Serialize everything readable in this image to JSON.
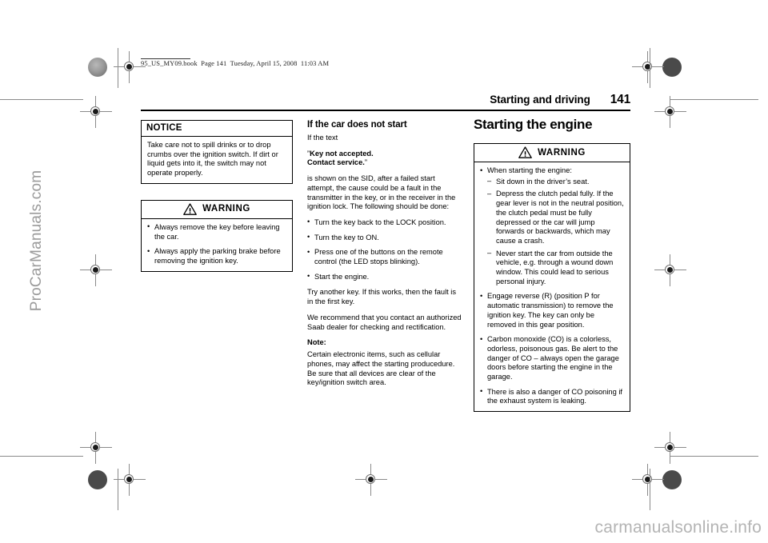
{
  "document": {
    "book_header": "95_US_MY09.book  Page 141  Tuesday, April 15, 2008  11:03 AM",
    "running_head_title": "Starting and driving",
    "page_number": "141"
  },
  "watermarks": {
    "left": "ProCarManuals.com",
    "bottom_right": "carmanualsonline.info"
  },
  "left_column": {
    "notice_box": {
      "title": "NOTICE",
      "body": "Take care not to spill drinks or to drop crumbs over the ignition switch. If dirt or liquid gets into it, the switch may not operate properly."
    },
    "warning_box": {
      "title": "WARNING",
      "icon": "warning-triangle-icon",
      "items": [
        "Always remove the key before leaving the car.",
        "Always apply the parking brake before removing the ignition key."
      ]
    }
  },
  "middle_column": {
    "heading": "If the car does not start",
    "intro": "If the text",
    "quote_open": "”",
    "quote_line1": "Key not accepted.",
    "quote_line2": "Contact service.",
    "quote_close": "”",
    "paragraph1": "is shown on the SID, after a failed start attempt, the cause could be a fault in the transmitter in the key, or in the receiver in the ignition lock. The following should be done:",
    "steps": [
      "Turn the key back to the LOCK position.",
      "Turn the key to ON.",
      "Press one of the buttons on the remote control (the LED stops blinking).",
      "Start the engine."
    ],
    "paragraph2": "Try another key. If this works, then the fault is in the first key.",
    "paragraph3": "We recommend that you contact an authorized Saab dealer for checking and rectification.",
    "note_label": "Note:",
    "note_text": "Certain electronic items, such as cellular phones, may affect the starting producedure. Be sure that all devices are clear of the key/ignition switch area."
  },
  "right_column": {
    "heading": "Starting the engine",
    "warning_box": {
      "title": "WARNING",
      "icon": "warning-triangle-icon",
      "items": [
        {
          "text": "When starting the engine:",
          "subitems": [
            "Sit down in the driver’s seat.",
            "Depress the clutch pedal fully. If the gear lever is not in the neutral position, the clutch pedal must be fully depressed or the car will jump forwards or backwards, which may cause a crash.",
            "Never start the car from outside the vehicle, e.g. through a wound down window. This could lead to serious personal injury."
          ]
        },
        {
          "text": "Engage reverse (R) (position P for automatic transmission) to remove the ignition key. The key can only be removed in this gear position.",
          "subitems": []
        },
        {
          "text": "Carbon monoxide (CO) is a colorless, odorless, poisonous gas. Be alert to the danger of CO – always open the garage doors before starting the engine in the garage.",
          "subitems": []
        },
        {
          "text": "There is also a danger of CO poisoning if the exhaust system is leaking.",
          "subitems": []
        }
      ]
    }
  },
  "glyphs": {
    "bullet": "•",
    "dash": "–"
  }
}
